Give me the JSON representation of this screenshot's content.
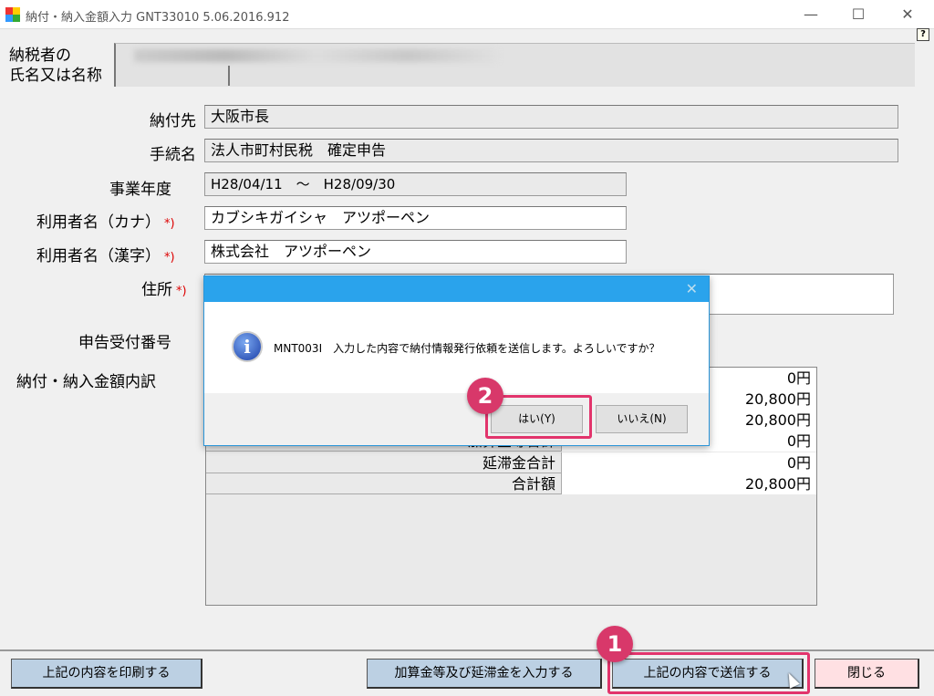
{
  "window": {
    "title": "納付・納入金額入力 GNT33010  5.06.2016.912",
    "minimize": "—",
    "maximize": "☐",
    "close": "✕",
    "help": "?"
  },
  "taxpayer": {
    "label_line1": "納税者の",
    "label_line2": "氏名又は名称"
  },
  "form": {
    "payee": {
      "label": "納付先",
      "value": "大阪市長"
    },
    "procedure": {
      "label": "手続名",
      "value": "法人市町村民税　確定申告"
    },
    "fiscal_year": {
      "label": "事業年度",
      "value": "H28/04/11　～　H28/09/30"
    },
    "user_kana": {
      "label": "利用者名（カナ）",
      "required": "*)",
      "value": "カブシキガイシャ　アツポーペン"
    },
    "user_kanji": {
      "label": "利用者名（漢字）",
      "required": "*)",
      "value": "株式会社　アツポーペン"
    },
    "address": {
      "label": "住所",
      "required": "*)",
      "value": ""
    },
    "receipt_no": {
      "label": "申告受付番号"
    },
    "breakdown": {
      "label": "納付・納入金額内訳"
    }
  },
  "table": {
    "rows": [
      {
        "label": "",
        "value": "0円"
      },
      {
        "label": "",
        "value": "20,800円"
      },
      {
        "label": "",
        "value": "20,800円"
      },
      {
        "label": "加算金等合計",
        "value": "0円"
      },
      {
        "label": "延滞金合計",
        "value": "0円"
      },
      {
        "label": "合計額",
        "value": "20,800円"
      }
    ]
  },
  "dialog": {
    "close": "✕",
    "icon": "i",
    "message": "MNT003I　入力した内容で納付情報発行依頼を送信します。よろしいですか？",
    "yes": "はい(Y)",
    "no": "いいえ(N)"
  },
  "buttons": {
    "print": "上記の内容を印刷する",
    "add_interest": "加算金等及び延滞金を入力する",
    "send": "上記の内容で送信する",
    "close": "閉じる"
  },
  "callouts": {
    "one": "1",
    "two": "2"
  },
  "colors": {
    "highlight": "#e2346c",
    "dialog_title": "#2aa3ec"
  }
}
